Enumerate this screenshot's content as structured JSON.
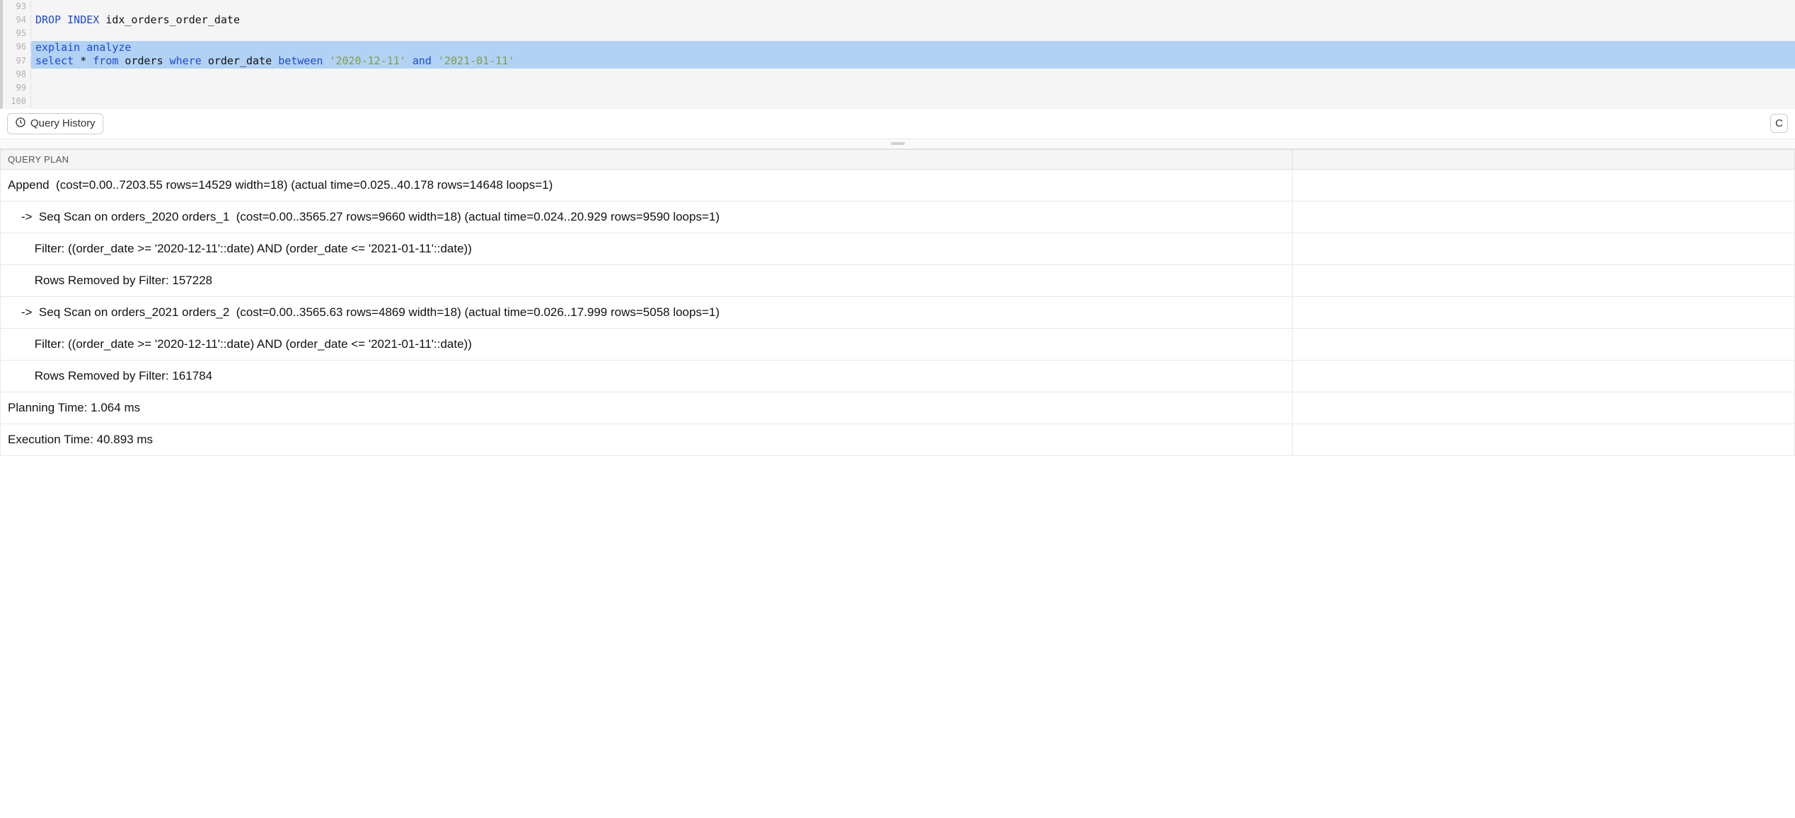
{
  "editor": {
    "lines": [
      {
        "num": "93",
        "highlighted": false,
        "tokens": []
      },
      {
        "num": "94",
        "highlighted": false,
        "tokens": [
          {
            "t": "DROP",
            "c": "kw-blue"
          },
          {
            "t": " ",
            "c": ""
          },
          {
            "t": "INDEX",
            "c": "kw-blue"
          },
          {
            "t": " idx_orders_order_date",
            "c": "kw-black"
          }
        ]
      },
      {
        "num": "95",
        "highlighted": false,
        "tokens": []
      },
      {
        "num": "96",
        "highlighted": true,
        "tokens": [
          {
            "t": "explain",
            "c": "kw-blue"
          },
          {
            "t": " ",
            "c": ""
          },
          {
            "t": "analyze",
            "c": "kw-blue"
          }
        ]
      },
      {
        "num": "97",
        "highlighted": true,
        "tokens": [
          {
            "t": "select",
            "c": "kw-blue"
          },
          {
            "t": " * ",
            "c": "kw-black"
          },
          {
            "t": "from",
            "c": "kw-blue"
          },
          {
            "t": " orders ",
            "c": "kw-black"
          },
          {
            "t": "where",
            "c": "kw-blue"
          },
          {
            "t": " order_date ",
            "c": "kw-black"
          },
          {
            "t": "between",
            "c": "kw-blue"
          },
          {
            "t": " ",
            "c": ""
          },
          {
            "t": "'2020-12-11'",
            "c": "kw-string"
          },
          {
            "t": " ",
            "c": ""
          },
          {
            "t": "and",
            "c": "kw-blue"
          },
          {
            "t": " ",
            "c": ""
          },
          {
            "t": "'2021-01-11'",
            "c": "kw-string"
          }
        ]
      },
      {
        "num": "98",
        "highlighted": false,
        "tokens": []
      },
      {
        "num": "99",
        "highlighted": false,
        "tokens": []
      },
      {
        "num": "100",
        "highlighted": false,
        "tokens": []
      }
    ]
  },
  "toolbar": {
    "query_history_label": "Query History",
    "right_button_visible_text": "C"
  },
  "results": {
    "header_col1": "QUERY PLAN",
    "rows": [
      {
        "text": "Append  (cost=0.00..7203.55 rows=14529 width=18) (actual time=0.025..40.178 rows=14648 loops=1)",
        "indent": 0
      },
      {
        "text": "->  Seq Scan on orders_2020 orders_1  (cost=0.00..3565.27 rows=9660 width=18) (actual time=0.024..20.929 rows=9590 loops=1)",
        "indent": 1
      },
      {
        "text": "Filter: ((order_date >= '2020-12-11'::date) AND (order_date <= '2021-01-11'::date))",
        "indent": 2
      },
      {
        "text": "Rows Removed by Filter: 157228",
        "indent": 2
      },
      {
        "text": "->  Seq Scan on orders_2021 orders_2  (cost=0.00..3565.63 rows=4869 width=18) (actual time=0.026..17.999 rows=5058 loops=1)",
        "indent": 1
      },
      {
        "text": "Filter: ((order_date >= '2020-12-11'::date) AND (order_date <= '2021-01-11'::date))",
        "indent": 2
      },
      {
        "text": "Rows Removed by Filter: 161784",
        "indent": 2
      },
      {
        "text": "Planning Time: 1.064 ms",
        "indent": 0
      },
      {
        "text": "Execution Time: 40.893 ms",
        "indent": 0
      }
    ]
  }
}
